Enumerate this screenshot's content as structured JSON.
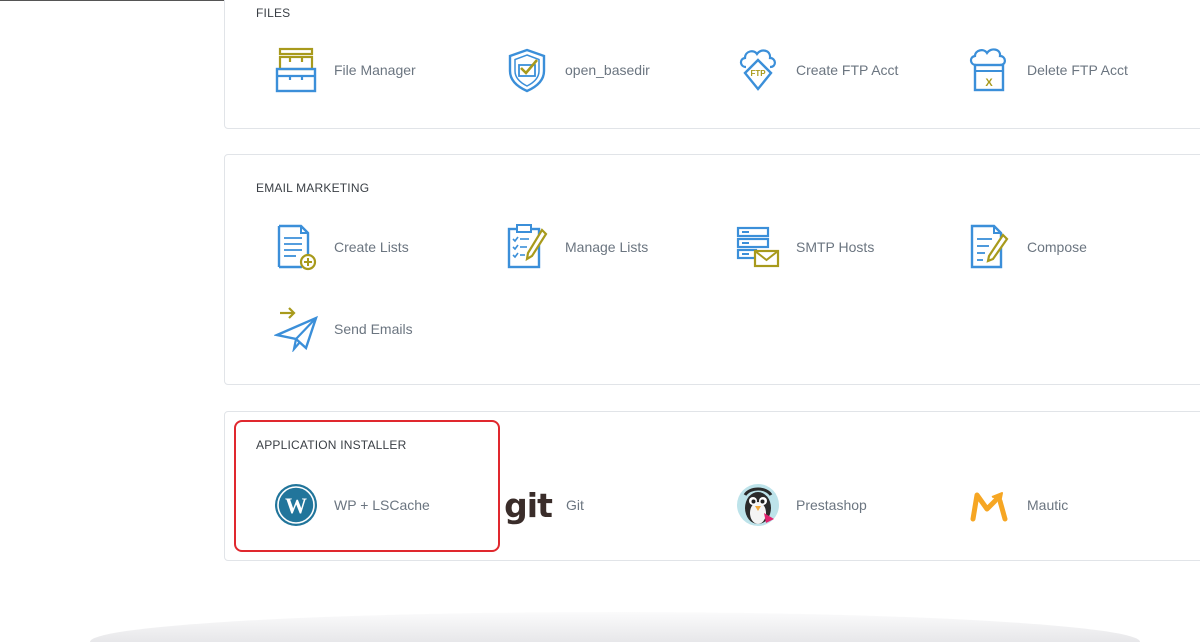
{
  "sections": {
    "files": {
      "title": "FILES",
      "items": [
        {
          "label": "File Manager",
          "icon": "file-manager-icon"
        },
        {
          "label": "open_basedir",
          "icon": "shield-check-icon"
        },
        {
          "label": "Create FTP Acct",
          "icon": "ftp-cloud-icon"
        },
        {
          "label": "Delete FTP Acct",
          "icon": "ftp-delete-icon"
        }
      ]
    },
    "email_marketing": {
      "title": "EMAIL MARKETING",
      "items": [
        {
          "label": "Create Lists",
          "icon": "create-list-icon"
        },
        {
          "label": "Manage Lists",
          "icon": "clipboard-checklist-icon"
        },
        {
          "label": "SMTP Hosts",
          "icon": "server-mail-icon"
        },
        {
          "label": "Compose",
          "icon": "compose-icon"
        },
        {
          "label": "Send Emails",
          "icon": "paper-plane-icon"
        }
      ]
    },
    "application_installer": {
      "title": "APPLICATION INSTALLER",
      "items": [
        {
          "label": "WP + LSCache",
          "icon": "wordpress-icon"
        },
        {
          "label": "Git",
          "icon": "git-icon",
          "logo_text": "git"
        },
        {
          "label": "Prestashop",
          "icon": "prestashop-icon"
        },
        {
          "label": "Mautic",
          "icon": "mautic-icon"
        }
      ]
    }
  },
  "colors": {
    "icon_blue": "#3b8fd9",
    "icon_olive": "#a89a1c",
    "highlight_red": "#e0282e",
    "label_gray": "#6b7580"
  }
}
